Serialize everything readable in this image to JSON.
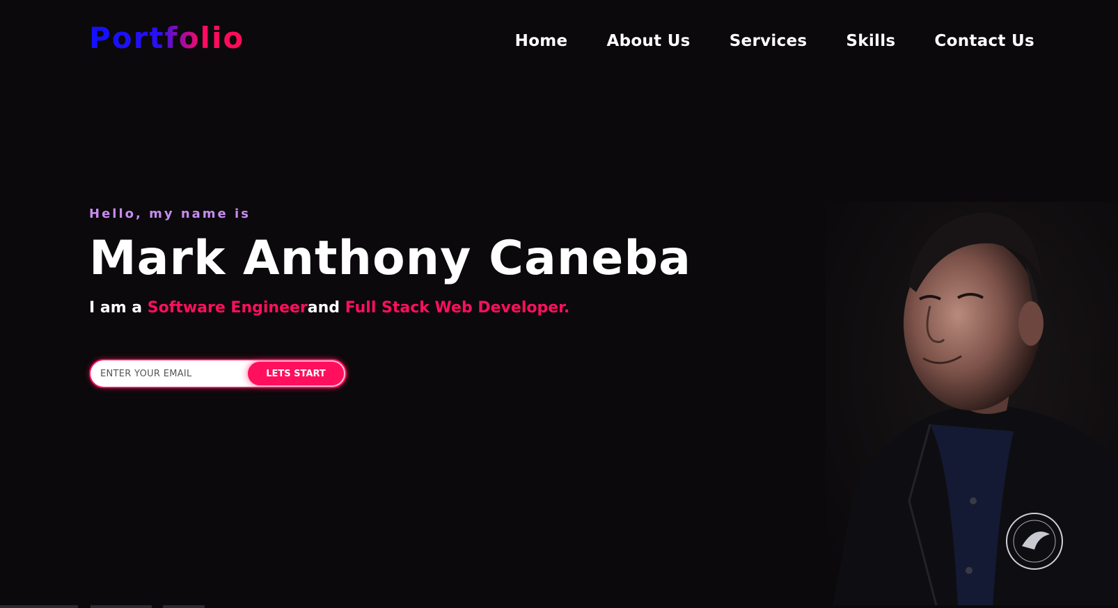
{
  "header": {
    "logo": "Portfolio",
    "nav": [
      "Home",
      "About Us",
      "Services",
      "Skills",
      "Contact Us"
    ]
  },
  "hero": {
    "greeting": "Hello, my name is",
    "name": "Mark Anthony Caneba",
    "tagline": {
      "prefix": "I am a ",
      "role1": "Software Engineer",
      "middle": "and ",
      "role2": "Full Stack Web Developer."
    }
  },
  "signup": {
    "email_placeholder": "ENTER YOUR EMAIL",
    "button_label": "LETS START"
  },
  "portrait": {
    "icon": "person-portrait-photo"
  },
  "colors": {
    "background": "#0b090b",
    "accent": "#ff0f5e",
    "greeting": "#c78cf0",
    "logo_blue": "#1010ff"
  }
}
